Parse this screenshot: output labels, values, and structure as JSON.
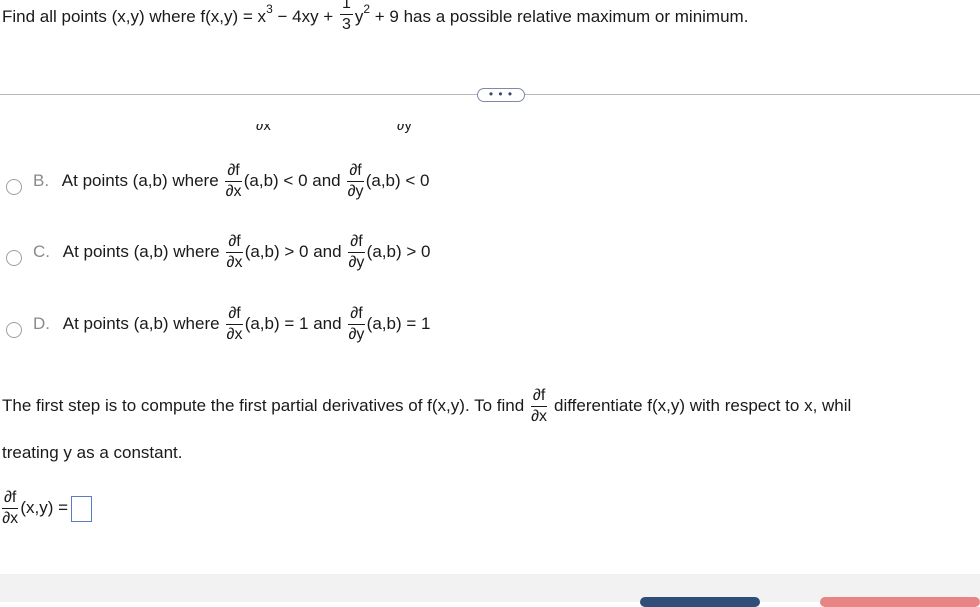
{
  "question": {
    "prefix": "Find all points (x,y) where f(x,y) = x",
    "exp3": "3",
    "middle": " − 4xy + ",
    "coef_num": "1",
    "coef_den": "3",
    "y": "y",
    "exp2": "2",
    "suffix": " + 9 has a possible relative maximum or minimum."
  },
  "more_label": "• • •",
  "cut_labels": {
    "left": "∂x",
    "right": "∂y"
  },
  "options": [
    {
      "letter": "B.",
      "text": "At points (a,b) where",
      "dnum": "∂f",
      "dx": "∂x",
      "cond1": "(a,b) < 0 and",
      "dy": "∂y",
      "cond2": "(a,b) < 0"
    },
    {
      "letter": "C.",
      "text": "At points (a,b) where",
      "dnum": "∂f",
      "dx": "∂x",
      "cond1": "(a,b) > 0 and",
      "dy": "∂y",
      "cond2": "(a,b) > 0"
    },
    {
      "letter": "D.",
      "text": "At points (a,b) where",
      "dnum": "∂f",
      "dx": "∂x",
      "cond1": "(a,b) = 1 and",
      "dy": "∂y",
      "cond2": "(a,b) = 1"
    }
  ],
  "step": {
    "line1_a": "The first step is to compute the first partial derivatives of f(x,y). To find",
    "frac_num": "∂f",
    "frac_den": "∂x",
    "line1_b": "differentiate f(x,y) with respect to x, whil",
    "line2": "treating y as a constant."
  },
  "answer": {
    "num": "∂f",
    "den": "∂x",
    "tail": "(x,y) ="
  }
}
